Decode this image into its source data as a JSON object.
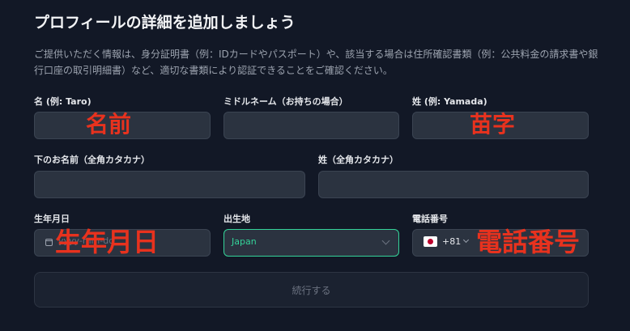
{
  "page": {
    "title": "プロフィールの詳細を追加しましょう",
    "description": "ご提供いただく情報は、身分証明書（例：IDカードやパスポート）や、該当する場合は住所確認書類（例：公共料金の請求書や銀行口座の取引明細書）など、適切な書類により認証できることをご確認ください。"
  },
  "form": {
    "first_name": {
      "label": "名 (例: Taro)",
      "value": ""
    },
    "middle_name": {
      "label": "ミドルネーム（お持ちの場合）",
      "value": ""
    },
    "last_name": {
      "label": "姓 (例: Yamada)",
      "value": ""
    },
    "first_name_kana": {
      "label": "下のお名前（全角カタカナ）",
      "value": ""
    },
    "last_name_kana": {
      "label": "姓（全角カタカナ）",
      "value": ""
    },
    "birthdate": {
      "label": "生年月日",
      "placeholder": "yyyy-mm-dd",
      "icon": "calendar-icon"
    },
    "birthplace": {
      "label": "出生地",
      "selected": "Japan",
      "icon": "chevron-down-icon"
    },
    "phone": {
      "label": "電話番号",
      "dial_code": "+81",
      "flag": "japan-flag-icon"
    },
    "submit_label": "続行する"
  },
  "annotations": {
    "first_name": "名前",
    "last_name": "苗字",
    "birthdate": "生年月日",
    "phone": "電話番号"
  },
  "colors": {
    "background": "#121826",
    "input": "#2b3340",
    "accent": "#34d399",
    "annotation": "#e8321e"
  }
}
